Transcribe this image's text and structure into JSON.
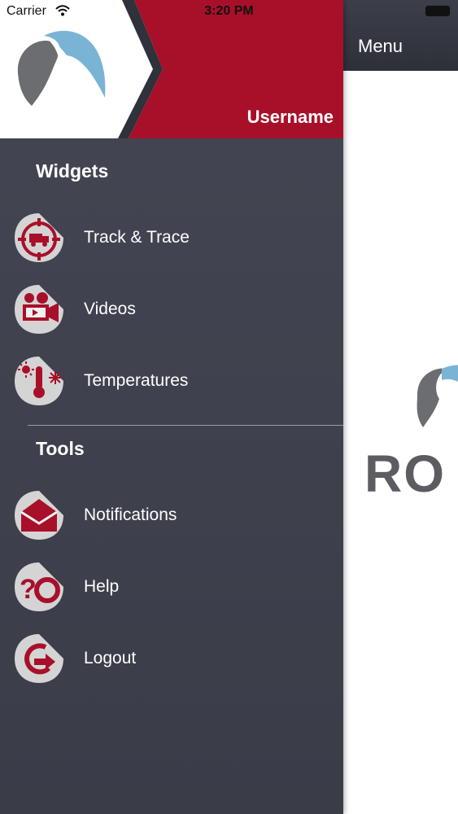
{
  "status_bar": {
    "carrier": "Carrier",
    "time": "3:20 PM"
  },
  "main": {
    "title": "Menu",
    "brand_text": "RO"
  },
  "drawer": {
    "username": "Username",
    "sections": [
      {
        "title": "Widgets",
        "items": [
          {
            "label": "Track & Trace",
            "icon": "truck-target-icon"
          },
          {
            "label": "Videos",
            "icon": "video-camera-icon"
          },
          {
            "label": "Temperatures",
            "icon": "thermometer-icon"
          }
        ]
      },
      {
        "title": "Tools",
        "items": [
          {
            "label": "Notifications",
            "icon": "envelope-icon"
          },
          {
            "label": "Help",
            "icon": "help-lifebuoy-icon"
          },
          {
            "label": "Logout",
            "icon": "logout-arrow-icon"
          }
        ]
      }
    ]
  },
  "colors": {
    "accent_red": "#a8102a",
    "drawer_bg": "#3f414d",
    "icon_bg": "#d4d4d4",
    "logo_gray": "#6b6d70",
    "logo_blue": "#7ab4d4"
  }
}
